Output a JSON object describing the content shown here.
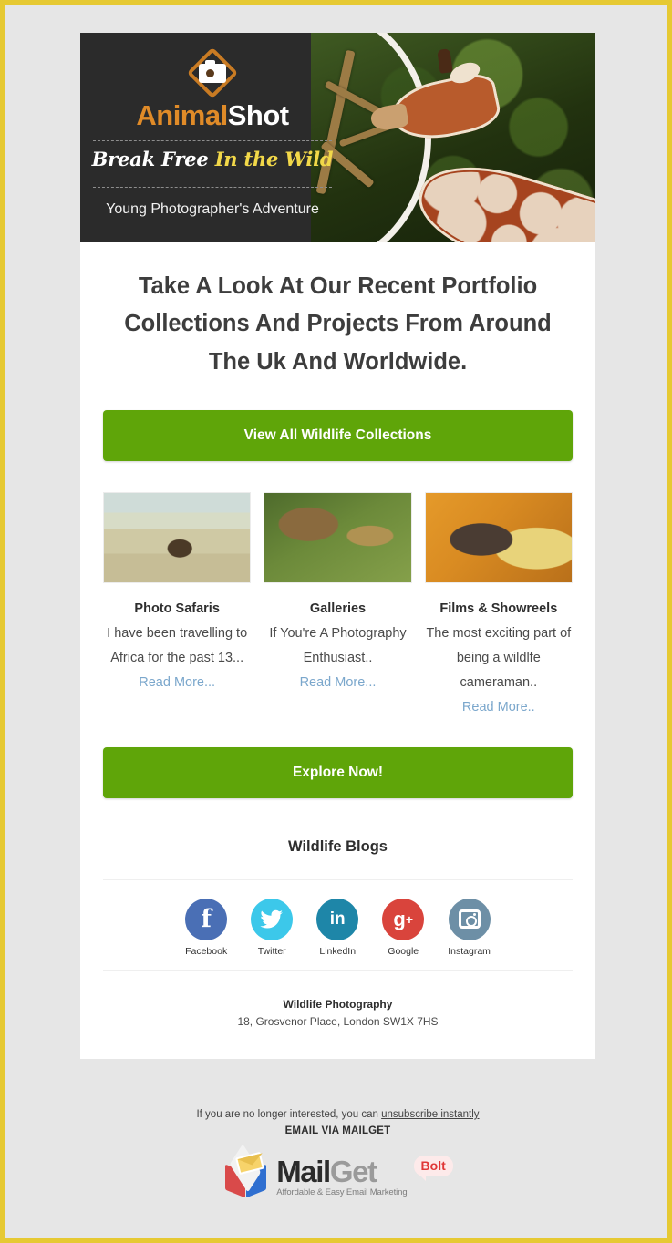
{
  "brand": {
    "name_part1": "Animal",
    "name_part2": "Shot",
    "tagline_white": "Break Free",
    "tagline_yellow": "In the Wild",
    "subtitle": "Young Photographer's Adventure",
    "logo_icon": "camera-diamond-icon"
  },
  "hero": {
    "photo_alt": "giraffe-eating-branches-photo"
  },
  "headline": "Take A Look At Our Recent Portfolio Collections And Projects From Around The Uk And Worldwide.",
  "cta_primary": "View All Wildlife Collections",
  "cta_secondary": "Explore Now!",
  "cards": [
    {
      "image": "bison-in-field-photo",
      "title": "Photo Safaris",
      "text": "I have been travelling to Africa for the past 13...",
      "link": "Read More..."
    },
    {
      "image": "deer-stag-photo",
      "title": "Galleries",
      "text": "If You're A Photography Enthusiast..",
      "link": "Read More..."
    },
    {
      "image": "gorilla-with-straw-photo",
      "title": "Films & Showreels",
      "text": "The most exciting part of being a wildlfe cameraman..",
      "link": "Read More.."
    }
  ],
  "blogs_heading": "Wildlife Blogs",
  "social": [
    {
      "label": "Facebook",
      "glyph": "f",
      "icon": "facebook-icon",
      "color": "#4a6fb5"
    },
    {
      "label": "Twitter",
      "glyph": "",
      "icon": "twitter-icon",
      "color": "#3cc8ea"
    },
    {
      "label": "LinkedIn",
      "glyph": "in",
      "icon": "linkedin-icon",
      "color": "#1e86a8"
    },
    {
      "label": "Google",
      "glyph": "g+",
      "icon": "google-plus-icon",
      "color": "#d9443c"
    },
    {
      "label": "Instagram",
      "glyph": "",
      "icon": "instagram-icon",
      "color": "#6d8fa6"
    }
  ],
  "address": {
    "name": "Wildlife Photography",
    "line": "18, Grosvenor Place, London SW1X 7HS"
  },
  "footer": {
    "unsub_prefix": "If you are no longer interested, you can ",
    "unsub_link": "unsubscribe instantly",
    "via": "EMAIL VIA MAILGET",
    "logo_name_dark": "Mail",
    "logo_name_gray": "Get",
    "logo_tagline": "Affordable & Easy Email Marketing",
    "logo_badge": "Bolt",
    "watermark": ""
  },
  "colors": {
    "accent_green": "#5fa509",
    "brand_orange": "#e08b28",
    "tagline_yellow": "#f2d849",
    "link_blue": "#7ba7cc",
    "header_dark": "#2b2b2b",
    "page_border": "#e6c933"
  }
}
